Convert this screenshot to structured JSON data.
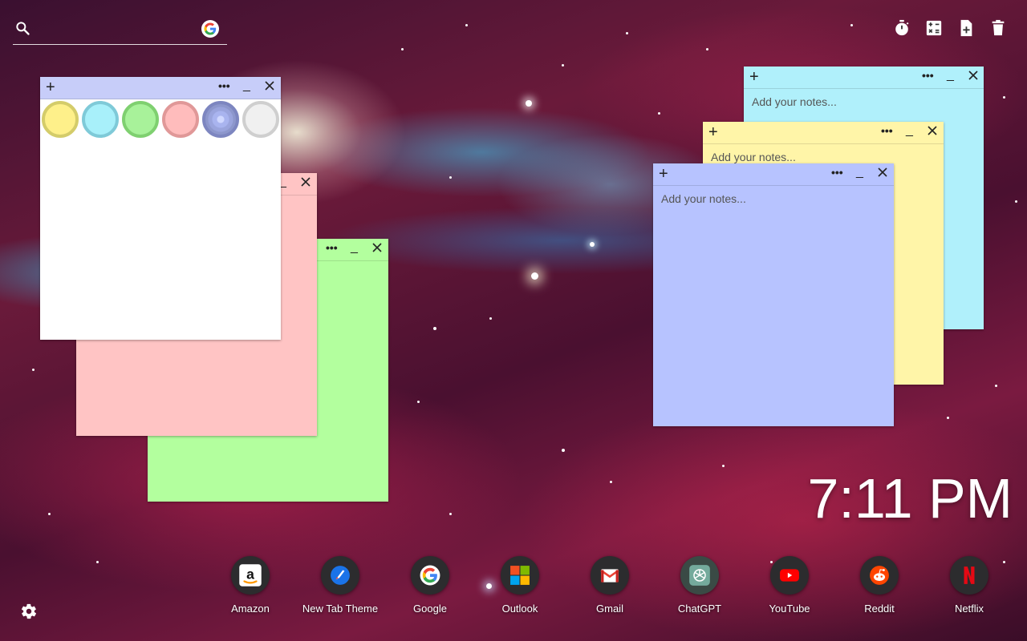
{
  "search": {
    "placeholder": "",
    "icon": "search-icon",
    "engine_icon": "google-icon"
  },
  "tools": [
    {
      "name": "timer-icon"
    },
    {
      "name": "calculator-icon"
    },
    {
      "name": "new-note-icon"
    },
    {
      "name": "trash-icon"
    }
  ],
  "notes": {
    "placeholder": "Add your notes...",
    "add_symbol": "+",
    "menu_symbol": "•••",
    "minimize_symbol": "_",
    "colors": {
      "white": "#ffffff",
      "pink": "#ffc4c4",
      "green": "#b3ff9e",
      "cyan": "#b0f0fb",
      "yellow": "#fff5a8",
      "lavender": "#b7c3ff",
      "header_lavender": "#c7cdf9"
    }
  },
  "color_picker": {
    "swatches": [
      {
        "name": "yellow",
        "fill": "#fef08a",
        "ring": "#d4cc6a"
      },
      {
        "name": "cyan",
        "fill": "#a8f0fa",
        "ring": "#7fcad8"
      },
      {
        "name": "green",
        "fill": "#a8f29a",
        "ring": "#7fd070"
      },
      {
        "name": "pink",
        "fill": "#ffbcbc",
        "ring": "#e09898"
      },
      {
        "name": "lavender",
        "fill": "#a9b4ef",
        "ring": "#7d86c0",
        "selected": true
      },
      {
        "name": "white",
        "fill": "#f0f0f0",
        "ring": "#cfcfcf"
      }
    ]
  },
  "clock": {
    "time": "7:11 PM"
  },
  "dock": [
    {
      "label": "Amazon",
      "icon": "amazon-icon"
    },
    {
      "label": "New Tab Theme",
      "icon": "new-tab-theme-icon"
    },
    {
      "label": "Google",
      "icon": "google-icon"
    },
    {
      "label": "Outlook",
      "icon": "outlook-icon"
    },
    {
      "label": "Gmail",
      "icon": "gmail-icon"
    },
    {
      "label": "ChatGPT",
      "icon": "chatgpt-icon"
    },
    {
      "label": "YouTube",
      "icon": "youtube-icon"
    },
    {
      "label": "Reddit",
      "icon": "reddit-icon"
    },
    {
      "label": "Netflix",
      "icon": "netflix-icon"
    }
  ],
  "settings": {
    "icon": "gear-icon"
  }
}
